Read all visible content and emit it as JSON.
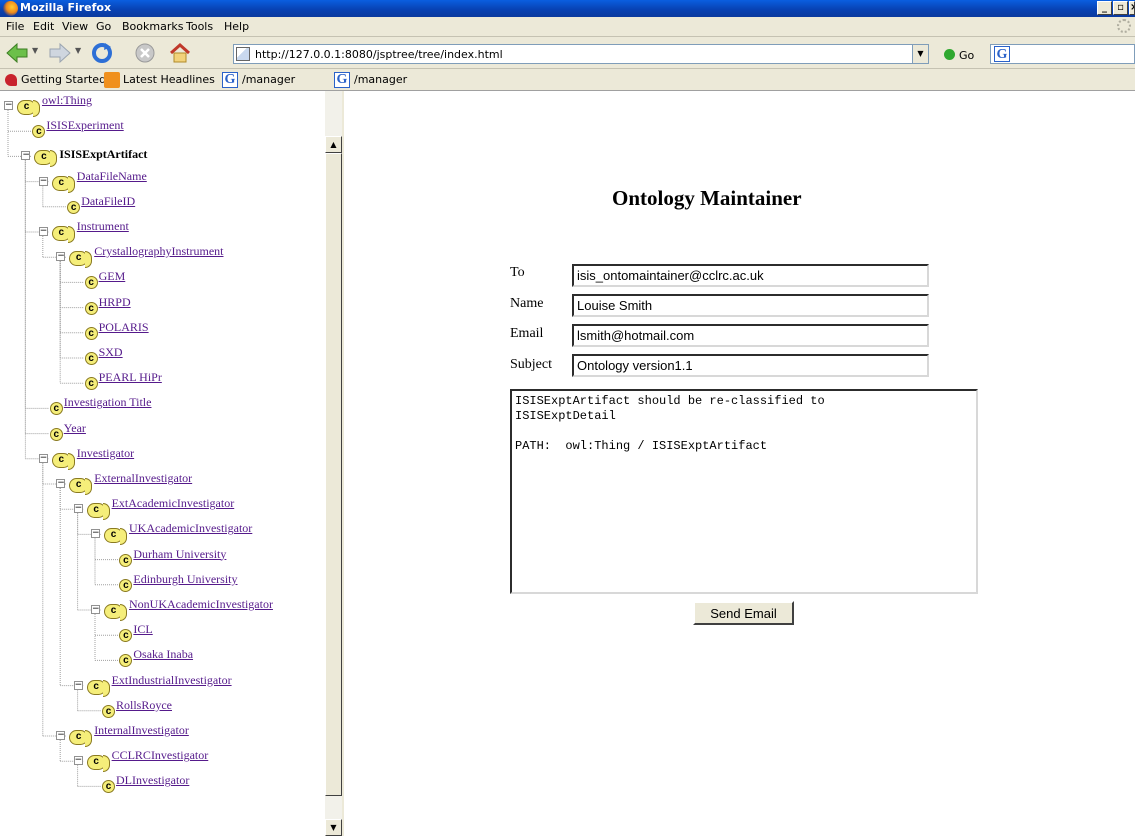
{
  "window": {
    "title": "Mozilla Firefox"
  },
  "menu": [
    "File",
    "Edit",
    "View",
    "Go",
    "Bookmarks",
    "Tools",
    "Help"
  ],
  "navbar": {
    "url": "http://127.0.0.1:8080/jsptree/tree/index.html",
    "go_label": "Go",
    "search_engine_icon": "google-g-icon"
  },
  "bookmarks": [
    {
      "label": "Getting Started",
      "icon": "getting-started-icon"
    },
    {
      "label": "Latest Headlines",
      "icon": "rss-icon"
    },
    {
      "label": "/manager",
      "icon": "google-g-icon"
    },
    {
      "label": "/manager",
      "icon": "google-g-icon"
    }
  ],
  "tree": [
    {
      "label": "owl:Thing",
      "depth": 0,
      "expander": true,
      "bold": false
    },
    {
      "label": "ISISExperiment",
      "depth": 1,
      "expander": false,
      "bold": false
    },
    {
      "label": "ISISExptArtifact",
      "depth": 1,
      "expander": true,
      "bold": true
    },
    {
      "label": "DataFileName",
      "depth": 2,
      "expander": true,
      "bold": false
    },
    {
      "label": "DataFileID",
      "depth": 3,
      "expander": false,
      "bold": false
    },
    {
      "label": "Instrument",
      "depth": 2,
      "expander": true,
      "bold": false
    },
    {
      "label": "CrystallographyInstrument",
      "depth": 3,
      "expander": true,
      "bold": false
    },
    {
      "label": "GEM",
      "depth": 4,
      "expander": false,
      "bold": false
    },
    {
      "label": "HRPD",
      "depth": 4,
      "expander": false,
      "bold": false
    },
    {
      "label": "POLARIS",
      "depth": 4,
      "expander": false,
      "bold": false
    },
    {
      "label": "SXD",
      "depth": 4,
      "expander": false,
      "bold": false
    },
    {
      "label": "PEARL HiPr",
      "depth": 4,
      "expander": false,
      "bold": false
    },
    {
      "label": "Investigation Title",
      "depth": 2,
      "expander": false,
      "bold": false
    },
    {
      "label": "Year",
      "depth": 2,
      "expander": false,
      "bold": false
    },
    {
      "label": "Investigator",
      "depth": 2,
      "expander": true,
      "bold": false
    },
    {
      "label": "ExternalInvestigator",
      "depth": 3,
      "expander": true,
      "bold": false
    },
    {
      "label": "ExtAcademicInvestigator",
      "depth": 4,
      "expander": true,
      "bold": false
    },
    {
      "label": "UKAcademicInvestigator",
      "depth": 5,
      "expander": true,
      "bold": false
    },
    {
      "label": "Durham University",
      "depth": 6,
      "expander": false,
      "bold": false
    },
    {
      "label": "Edinburgh University",
      "depth": 6,
      "expander": false,
      "bold": false
    },
    {
      "label": "NonUKAcademicInvestigator",
      "depth": 5,
      "expander": true,
      "bold": false
    },
    {
      "label": "ICL",
      "depth": 6,
      "expander": false,
      "bold": false
    },
    {
      "label": "Osaka Inaba",
      "depth": 6,
      "expander": false,
      "bold": false
    },
    {
      "label": "ExtIndustrialInvestigator",
      "depth": 4,
      "expander": true,
      "bold": false
    },
    {
      "label": "RollsRoyce",
      "depth": 5,
      "expander": false,
      "bold": false
    },
    {
      "label": "InternalInvestigator",
      "depth": 3,
      "expander": true,
      "bold": false
    },
    {
      "label": "CCLRCInvestigator",
      "depth": 4,
      "expander": true,
      "bold": false
    },
    {
      "label": "DLInvestigator",
      "depth": 5,
      "expander": false,
      "bold": false
    }
  ],
  "form": {
    "title": "Ontology Maintainer",
    "to_label": "To",
    "to_value": "isis_ontomaintainer@cclrc.ac.uk",
    "name_label": "Name",
    "name_value": "Louise Smith",
    "email_label": "Email",
    "email_value": "lsmith@hotmail.com",
    "subject_label": "Subject",
    "subject_value": "Ontology version1.1",
    "message": "ISISExptArtifact should be re-classified to\nISISExptDetail\n\nPATH:  owl:Thing / ISISExptArtifact",
    "send_label": "Send Email"
  }
}
